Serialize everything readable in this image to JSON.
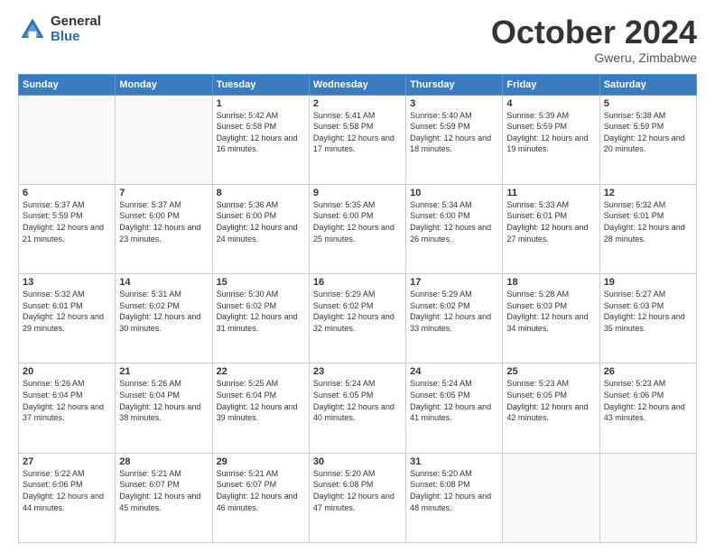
{
  "logo": {
    "general": "General",
    "blue": "Blue"
  },
  "header": {
    "month": "October 2024",
    "location": "Gweru, Zimbabwe"
  },
  "weekdays": [
    "Sunday",
    "Monday",
    "Tuesday",
    "Wednesday",
    "Thursday",
    "Friday",
    "Saturday"
  ],
  "weeks": [
    [
      {
        "day": "",
        "sunrise": "",
        "sunset": "",
        "daylight": ""
      },
      {
        "day": "",
        "sunrise": "",
        "sunset": "",
        "daylight": ""
      },
      {
        "day": "1",
        "sunrise": "Sunrise: 5:42 AM",
        "sunset": "Sunset: 5:58 PM",
        "daylight": "Daylight: 12 hours and 16 minutes."
      },
      {
        "day": "2",
        "sunrise": "Sunrise: 5:41 AM",
        "sunset": "Sunset: 5:58 PM",
        "daylight": "Daylight: 12 hours and 17 minutes."
      },
      {
        "day": "3",
        "sunrise": "Sunrise: 5:40 AM",
        "sunset": "Sunset: 5:59 PM",
        "daylight": "Daylight: 12 hours and 18 minutes."
      },
      {
        "day": "4",
        "sunrise": "Sunrise: 5:39 AM",
        "sunset": "Sunset: 5:59 PM",
        "daylight": "Daylight: 12 hours and 19 minutes."
      },
      {
        "day": "5",
        "sunrise": "Sunrise: 5:38 AM",
        "sunset": "Sunset: 5:59 PM",
        "daylight": "Daylight: 12 hours and 20 minutes."
      }
    ],
    [
      {
        "day": "6",
        "sunrise": "Sunrise: 5:37 AM",
        "sunset": "Sunset: 5:59 PM",
        "daylight": "Daylight: 12 hours and 21 minutes."
      },
      {
        "day": "7",
        "sunrise": "Sunrise: 5:37 AM",
        "sunset": "Sunset: 6:00 PM",
        "daylight": "Daylight: 12 hours and 23 minutes."
      },
      {
        "day": "8",
        "sunrise": "Sunrise: 5:36 AM",
        "sunset": "Sunset: 6:00 PM",
        "daylight": "Daylight: 12 hours and 24 minutes."
      },
      {
        "day": "9",
        "sunrise": "Sunrise: 5:35 AM",
        "sunset": "Sunset: 6:00 PM",
        "daylight": "Daylight: 12 hours and 25 minutes."
      },
      {
        "day": "10",
        "sunrise": "Sunrise: 5:34 AM",
        "sunset": "Sunset: 6:00 PM",
        "daylight": "Daylight: 12 hours and 26 minutes."
      },
      {
        "day": "11",
        "sunrise": "Sunrise: 5:33 AM",
        "sunset": "Sunset: 6:01 PM",
        "daylight": "Daylight: 12 hours and 27 minutes."
      },
      {
        "day": "12",
        "sunrise": "Sunrise: 5:32 AM",
        "sunset": "Sunset: 6:01 PM",
        "daylight": "Daylight: 12 hours and 28 minutes."
      }
    ],
    [
      {
        "day": "13",
        "sunrise": "Sunrise: 5:32 AM",
        "sunset": "Sunset: 6:01 PM",
        "daylight": "Daylight: 12 hours and 29 minutes."
      },
      {
        "day": "14",
        "sunrise": "Sunrise: 5:31 AM",
        "sunset": "Sunset: 6:02 PM",
        "daylight": "Daylight: 12 hours and 30 minutes."
      },
      {
        "day": "15",
        "sunrise": "Sunrise: 5:30 AM",
        "sunset": "Sunset: 6:02 PM",
        "daylight": "Daylight: 12 hours and 31 minutes."
      },
      {
        "day": "16",
        "sunrise": "Sunrise: 5:29 AM",
        "sunset": "Sunset: 6:02 PM",
        "daylight": "Daylight: 12 hours and 32 minutes."
      },
      {
        "day": "17",
        "sunrise": "Sunrise: 5:29 AM",
        "sunset": "Sunset: 6:02 PM",
        "daylight": "Daylight: 12 hours and 33 minutes."
      },
      {
        "day": "18",
        "sunrise": "Sunrise: 5:28 AM",
        "sunset": "Sunset: 6:03 PM",
        "daylight": "Daylight: 12 hours and 34 minutes."
      },
      {
        "day": "19",
        "sunrise": "Sunrise: 5:27 AM",
        "sunset": "Sunset: 6:03 PM",
        "daylight": "Daylight: 12 hours and 35 minutes."
      }
    ],
    [
      {
        "day": "20",
        "sunrise": "Sunrise: 5:26 AM",
        "sunset": "Sunset: 6:04 PM",
        "daylight": "Daylight: 12 hours and 37 minutes."
      },
      {
        "day": "21",
        "sunrise": "Sunrise: 5:26 AM",
        "sunset": "Sunset: 6:04 PM",
        "daylight": "Daylight: 12 hours and 38 minutes."
      },
      {
        "day": "22",
        "sunrise": "Sunrise: 5:25 AM",
        "sunset": "Sunset: 6:04 PM",
        "daylight": "Daylight: 12 hours and 39 minutes."
      },
      {
        "day": "23",
        "sunrise": "Sunrise: 5:24 AM",
        "sunset": "Sunset: 6:05 PM",
        "daylight": "Daylight: 12 hours and 40 minutes."
      },
      {
        "day": "24",
        "sunrise": "Sunrise: 5:24 AM",
        "sunset": "Sunset: 6:05 PM",
        "daylight": "Daylight: 12 hours and 41 minutes."
      },
      {
        "day": "25",
        "sunrise": "Sunrise: 5:23 AM",
        "sunset": "Sunset: 6:05 PM",
        "daylight": "Daylight: 12 hours and 42 minutes."
      },
      {
        "day": "26",
        "sunrise": "Sunrise: 5:23 AM",
        "sunset": "Sunset: 6:06 PM",
        "daylight": "Daylight: 12 hours and 43 minutes."
      }
    ],
    [
      {
        "day": "27",
        "sunrise": "Sunrise: 5:22 AM",
        "sunset": "Sunset: 6:06 PM",
        "daylight": "Daylight: 12 hours and 44 minutes."
      },
      {
        "day": "28",
        "sunrise": "Sunrise: 5:21 AM",
        "sunset": "Sunset: 6:07 PM",
        "daylight": "Daylight: 12 hours and 45 minutes."
      },
      {
        "day": "29",
        "sunrise": "Sunrise: 5:21 AM",
        "sunset": "Sunset: 6:07 PM",
        "daylight": "Daylight: 12 hours and 46 minutes."
      },
      {
        "day": "30",
        "sunrise": "Sunrise: 5:20 AM",
        "sunset": "Sunset: 6:08 PM",
        "daylight": "Daylight: 12 hours and 47 minutes."
      },
      {
        "day": "31",
        "sunrise": "Sunrise: 5:20 AM",
        "sunset": "Sunset: 6:08 PM",
        "daylight": "Daylight: 12 hours and 48 minutes."
      },
      {
        "day": "",
        "sunrise": "",
        "sunset": "",
        "daylight": ""
      },
      {
        "day": "",
        "sunrise": "",
        "sunset": "",
        "daylight": ""
      }
    ]
  ]
}
